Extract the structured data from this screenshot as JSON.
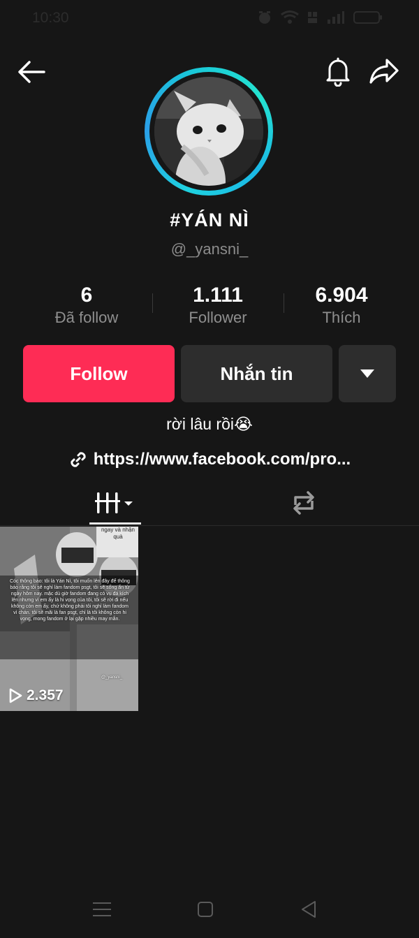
{
  "status_bar": {
    "time": "10:30"
  },
  "profile": {
    "display_name": "#YÁN NÌ",
    "username": "@_yansni_",
    "bio": "rời lâu rồi😭",
    "link": "https://www.facebook.com/pro..."
  },
  "stats": [
    {
      "value": "6",
      "label": "Đã follow"
    },
    {
      "value": "1.111",
      "label": "Follower"
    },
    {
      "value": "6.904",
      "label": "Thích"
    }
  ],
  "actions": {
    "follow_label": "Follow",
    "message_label": "Nhắn tin"
  },
  "tabs": {
    "videos_icon": "grid-lines-icon",
    "reposts_icon": "repost-icon",
    "active": "videos"
  },
  "videos": [
    {
      "views": "2.357",
      "overlay_top": "ngay và nhận quà",
      "overlay_text": "Cóc thông báo: tôi là Yán Nì, tôi muốn lên đây để thông báo rằng tôi sẽ nghỉ làm fandom psgt, tôi sẽ sống ẩn từ ngày hôm nay. mặc dù giờ fandom đang có vụ đá kích lên nhưng vì em ấy là hi vọng của tôi, tôi sẽ rời đi nếu không còn em ấy, chứ không phải tôi nghỉ làm fandom vì chán. tôi sẽ mãi là fan psgt, chỉ là tôi không còn hi vọng, mong fandom ở lại gặp nhiều may mắn.",
      "watermark": "@_yansni_"
    }
  ],
  "colors": {
    "accent": "#fe2c55",
    "ring": "#1fd2e0",
    "background": "#161616",
    "secondary_button": "#2d2d2d"
  }
}
